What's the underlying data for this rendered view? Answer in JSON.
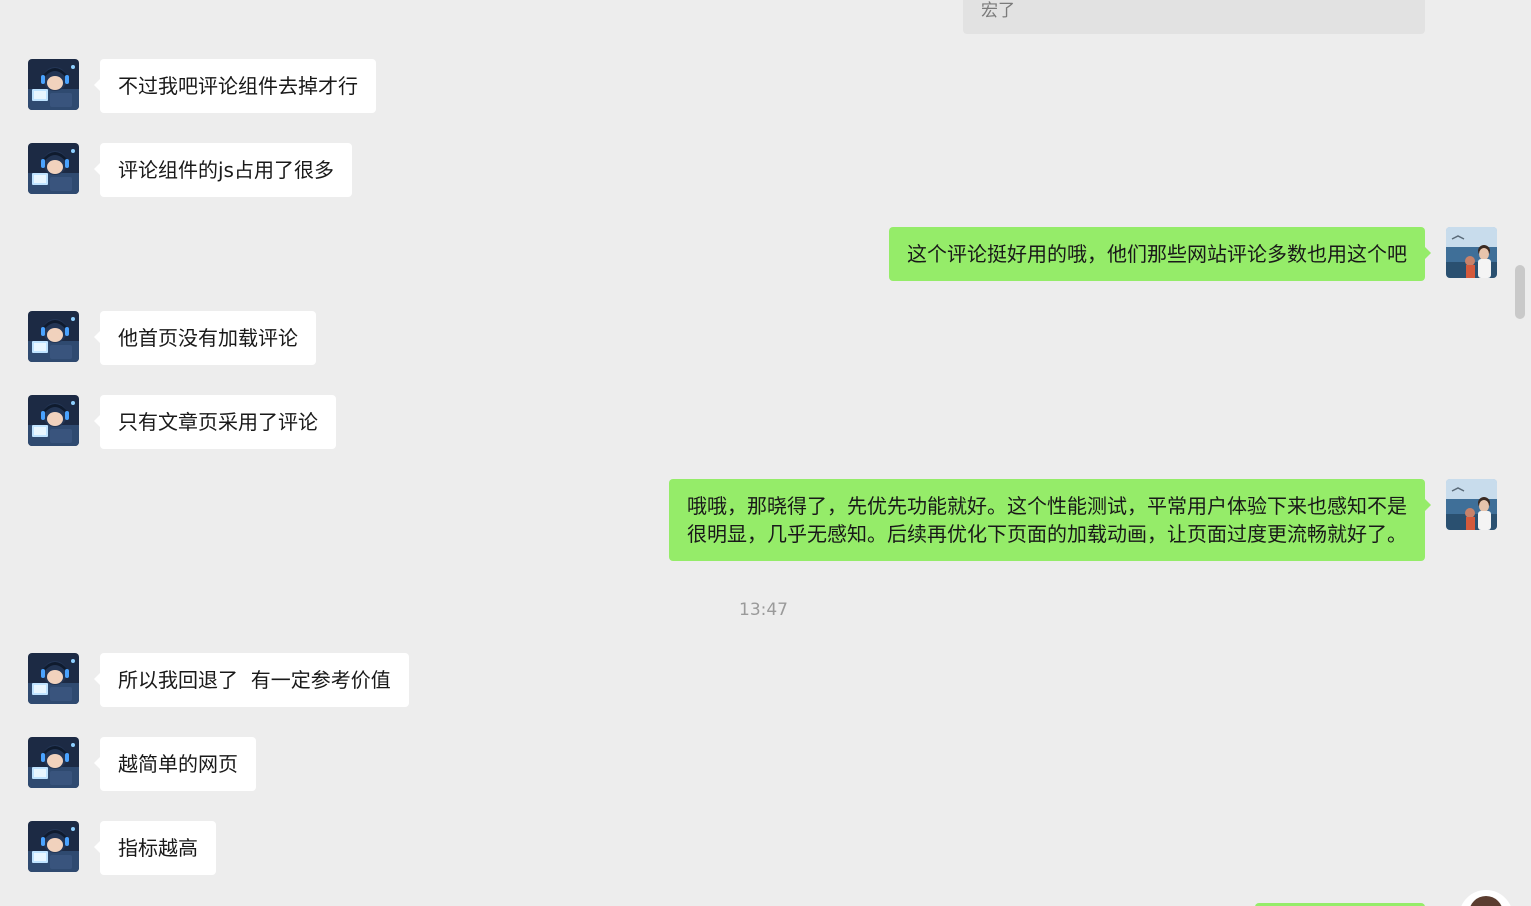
{
  "quoted_text": "宏了",
  "messages_top": [
    {
      "side": "left",
      "text": "不过我吧评论组件去掉才行"
    },
    {
      "side": "left",
      "text": "评论组件的js占用了很多"
    },
    {
      "side": "right",
      "text": "这个评论挺好用的哦，他们那些网站评论多数也用这个吧"
    },
    {
      "side": "left",
      "text": "他首页没有加载评论"
    },
    {
      "side": "left",
      "text": "只有文章页采用了评论"
    }
  ],
  "reply_long": {
    "line1": "哦哦，那晓得了，先优先功能就好。这个性能测试，平常用户体验下来也感知不是",
    "line2": "很明显，几乎无感知。后续再优化下页面的加载动画，让页面过度更流畅就好了。"
  },
  "timestamp": "13:47",
  "messages_bottom": [
    {
      "side": "left",
      "text": "所以我回退了  有一定参考价值"
    },
    {
      "side": "left",
      "text": "越简单的网页"
    },
    {
      "side": "left",
      "text": "指标越高"
    }
  ],
  "colors": {
    "background": "#ededed",
    "bubble_self": "#95ec69",
    "bubble_other": "#ffffff",
    "timestamp": "#9a9a9a"
  },
  "icons": {
    "contact_avatar": "anime-character-avatar",
    "self_avatar": "seaside-photo-avatar"
  }
}
